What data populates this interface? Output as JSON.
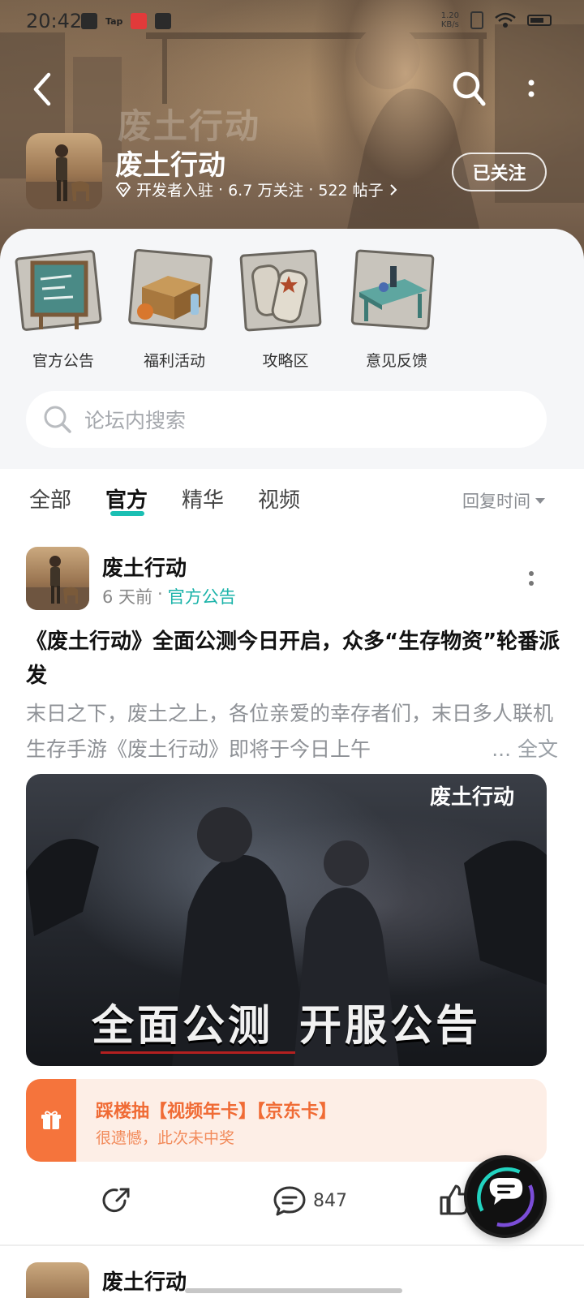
{
  "status_bar": {
    "time": "20:42",
    "tap_label": "Tap",
    "network_speed": "1.20",
    "network_unit": "KB/s"
  },
  "header": {
    "watermark": "废土行动",
    "game_title": "废土行动",
    "meta": {
      "developer": "开发者入驻",
      "followers": "6.7 万关注",
      "posts": "522 帖子"
    },
    "follow_button": "已关注"
  },
  "quick_entries": [
    {
      "label": "官方公告",
      "icon": "noticeboard-icon"
    },
    {
      "label": "福利活动",
      "icon": "supply-box-icon"
    },
    {
      "label": "攻略区",
      "icon": "dog-tags-icon"
    },
    {
      "label": "意见反馈",
      "icon": "workbench-icon"
    }
  ],
  "search": {
    "placeholder": "论坛内搜索"
  },
  "tabs": {
    "items": [
      "全部",
      "官方",
      "精华",
      "视频"
    ],
    "active": "官方",
    "sort_label": "回复时间"
  },
  "post": {
    "author": "废土行动",
    "time": "6 天前",
    "separator": "·",
    "tag": "官方公告",
    "title": "《废土行动》全面公测今日开启，众多“生存物资”轮番派发",
    "excerpt": "末日之下，废土之上，各位亲爱的幸存者们，末日多人联机生存手游《废土行动》即将于今日上午",
    "ellipsis": "...",
    "full_text_link": "全文",
    "image": {
      "logo_text": "废土行动",
      "banner_left": "全面公测",
      "banner_right": "开服公告"
    },
    "lottery": {
      "title": "踩楼抽【视频年卡】【京东卡】",
      "result": "很遗憾，此次未中奖"
    },
    "comment_count": "847"
  },
  "next_post": {
    "author": "废土行动"
  },
  "colors": {
    "accent": "#1bbfb3",
    "lottery": "#f5743c"
  }
}
